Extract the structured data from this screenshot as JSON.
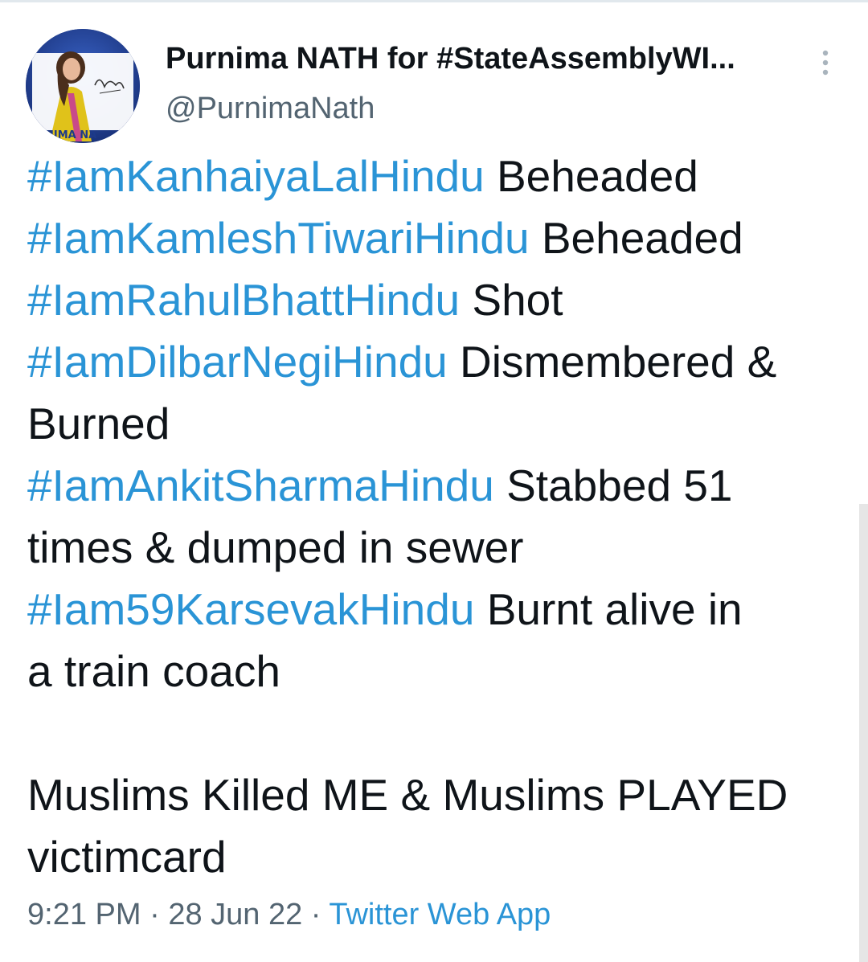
{
  "author": {
    "display_name": "Purnima NATH for #StateAssemblyWI...",
    "handle": "@PurnimaNath",
    "avatar_caption": "RNIMA NA"
  },
  "tweet": {
    "lines": [
      {
        "hashtag": "#IamKanhaiyaLalHindu",
        "text": " Beheaded"
      },
      {
        "hashtag": "#IamKamleshTiwariHindu",
        "text": " Beheaded"
      },
      {
        "hashtag": "#IamRahulBhattHindu",
        "text": " Shot"
      },
      {
        "hashtag": "#IamDilbarNegiHindu",
        "text": " Dismembered &"
      },
      {
        "hashtag": "",
        "text": "Burned"
      },
      {
        "hashtag": "#IamAnkitSharmaHindu",
        "text": " Stabbed 51"
      },
      {
        "hashtag": "",
        "text": "times & dumped in sewer"
      },
      {
        "hashtag": "#Iam59KarsevakHindu",
        "text": " Burnt alive in"
      },
      {
        "hashtag": "",
        "text": "a train coach"
      },
      {
        "hashtag": "",
        "text": ""
      },
      {
        "hashtag": "",
        "text": "Muslims Killed ME & Muslims PLAYED"
      },
      {
        "hashtag": "",
        "text": "victimcard"
      }
    ]
  },
  "meta": {
    "time": "9:21 PM",
    "sep1": " · ",
    "date": "28 Jun 22",
    "sep2": " · ",
    "source": "Twitter Web App"
  },
  "icons": {
    "more": "more-vertical-icon",
    "avatar": "avatar-image"
  },
  "colors": {
    "hashtag": "#2a94d6",
    "text": "#0f1419",
    "secondary": "#536471"
  }
}
